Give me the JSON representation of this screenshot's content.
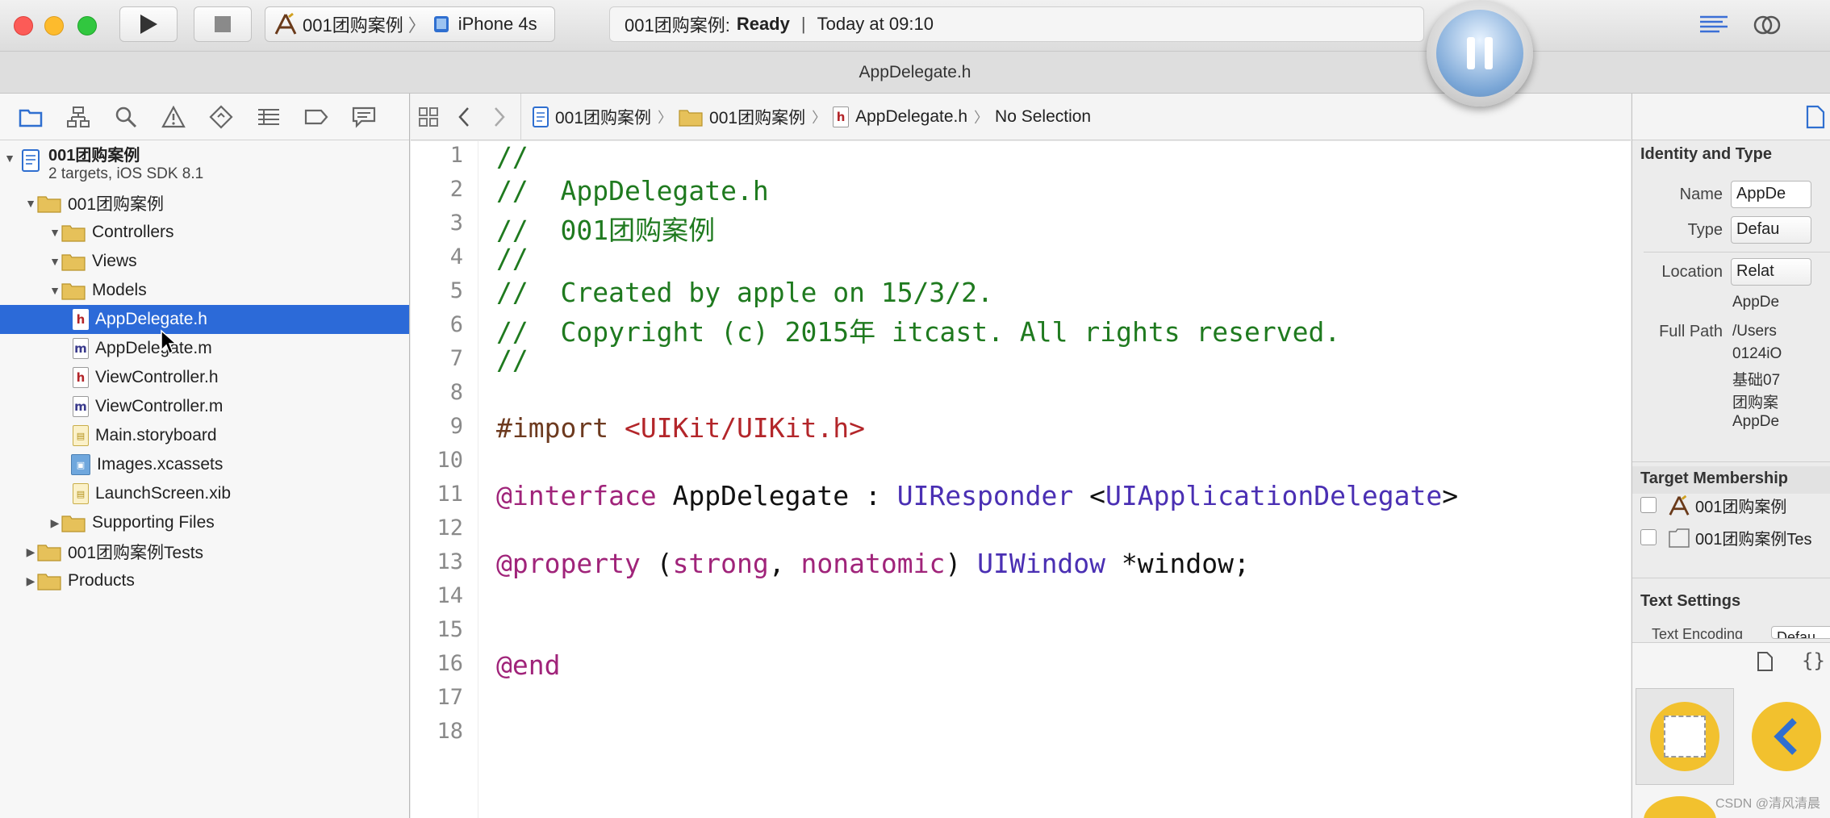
{
  "toolbar": {
    "scheme_name": "001团购案例",
    "device": "iPhone 4s",
    "activity_project": "001团购案例:",
    "activity_status": "Ready",
    "activity_time": "Today at 09:10"
  },
  "window_title": "AppDelegate.h",
  "navigator": {
    "project": {
      "name": "001团购案例",
      "subtitle": "2 targets, iOS SDK 8.1"
    },
    "items": [
      {
        "label": "001团购案例"
      },
      {
        "label": "Controllers"
      },
      {
        "label": "Views"
      },
      {
        "label": "Models"
      },
      {
        "label": "AppDelegate.h"
      },
      {
        "label": "AppDelegate.m"
      },
      {
        "label": "ViewController.h"
      },
      {
        "label": "ViewController.m"
      },
      {
        "label": "Main.storyboard"
      },
      {
        "label": "Images.xcassets"
      },
      {
        "label": "LaunchScreen.xib"
      },
      {
        "label": "Supporting Files"
      },
      {
        "label": "001团购案例Tests"
      },
      {
        "label": "Products"
      }
    ]
  },
  "jump_bar": {
    "crumbs": [
      "001团购案例",
      "001团购案例",
      "AppDelegate.h",
      "No Selection"
    ]
  },
  "editor": {
    "line_numbers": [
      "1",
      "2",
      "3",
      "4",
      "5",
      "6",
      "7",
      "8",
      "9",
      "10",
      "11",
      "12",
      "13",
      "14",
      "15",
      "16",
      "17",
      "18"
    ],
    "l1": "//",
    "l2": "//  AppDelegate.h",
    "l3": "//  001团购案例",
    "l4": "//",
    "l5": "//  Created by apple on 15/3/2.",
    "l6": "//  Copyright (c) 2015年 itcast. All rights reserved.",
    "l7": "//",
    "l9_import": "#import ",
    "l9_header": "<UIKit/UIKit.h>",
    "l11_kw": "@interface",
    "l11_name": " AppDelegate : ",
    "l11_super": "UIResponder",
    "l11_lt": " <",
    "l11_proto": "UIApplicationDelegate",
    "l11_gt": ">",
    "l13_kw": "@property",
    "l13_open": " (",
    "l13_attr1": "strong",
    "l13_comma": ", ",
    "l13_attr2": "nonatomic",
    "l13_close": ") ",
    "l13_type": "UIWindow",
    "l13_var": " *window;",
    "l16": "@end"
  },
  "inspector": {
    "identity_header": "Identity and Type",
    "name_label": "Name",
    "name_value": "AppDe",
    "type_label": "Type",
    "type_value": "Defau",
    "location_label": "Location",
    "location_value": "Relat",
    "location_file": "AppDe",
    "full_path_label": "Full Path",
    "full_path_lines": [
      "/Users",
      "0124iO",
      "基础07",
      "团购案",
      "AppDe"
    ],
    "target_header": "Target Membership",
    "targets": [
      "001团购案例",
      "001团购案例Tes"
    ],
    "text_settings_header": "Text Settings",
    "text_encoding_label": "Text Encoding",
    "text_encoding_value": "Defau"
  },
  "watermark": "CSDN @清风清晨",
  "colors": {
    "selection": "#2c6ad8",
    "comment": "#1f7a1f",
    "keyword": "#a0247a",
    "type": "#4a2fb3",
    "string": "#b3262a"
  }
}
